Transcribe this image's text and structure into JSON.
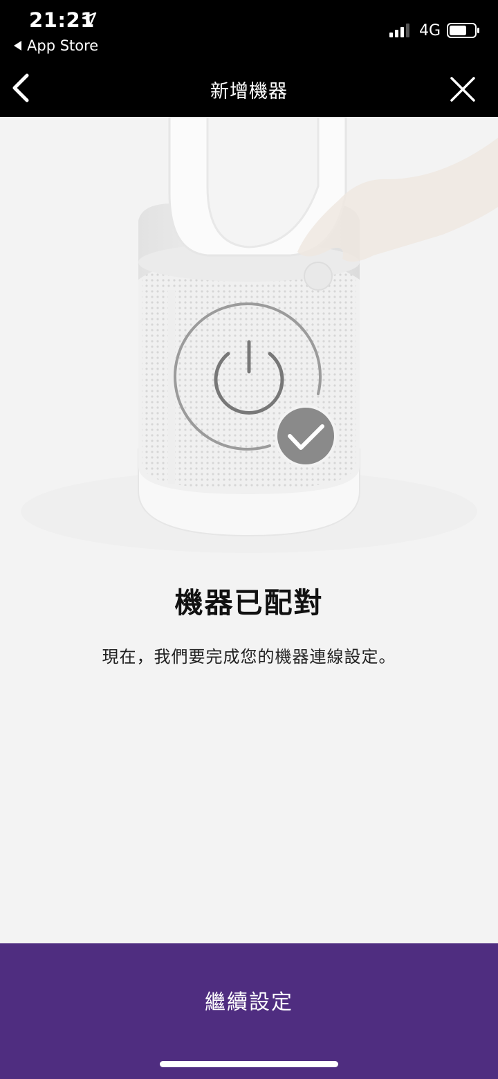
{
  "status_bar": {
    "time": "21:21",
    "back_app": "App Store",
    "network": "4G",
    "icons": [
      "location-arrow-icon",
      "signal-icon",
      "battery-icon"
    ]
  },
  "nav": {
    "title": "新增機器",
    "icons": [
      "chevron-left-icon",
      "close-icon"
    ]
  },
  "main": {
    "heading": "機器已配對",
    "body": "現在，我們要完成您的機器連線設定。",
    "illustration_icons": [
      "power-icon",
      "checkmark-icon"
    ]
  },
  "footer": {
    "button_label": "繼續設定"
  },
  "colors": {
    "bar": "#000000",
    "background": "#f3f3f3",
    "accent": "#4f2d80",
    "check_badge": "#8a8a8a"
  }
}
